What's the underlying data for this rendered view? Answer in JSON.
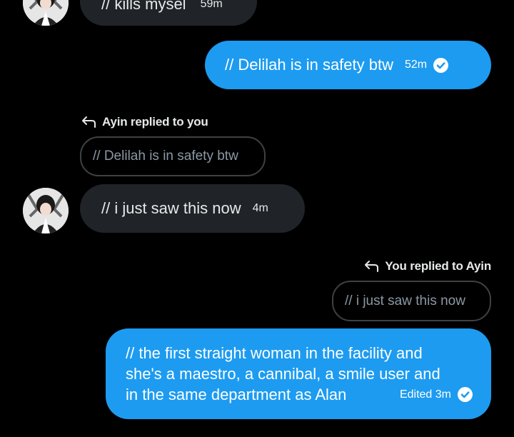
{
  "messages": {
    "top_in": {
      "text": "// kills mysel",
      "time": "59m"
    },
    "out1": {
      "text": "// Delilah is in safety btw",
      "time": "52m"
    },
    "reply1": {
      "label": "Ayin replied to you",
      "quote": "// Delilah is in safety btw"
    },
    "in2": {
      "text": "// i just saw this now",
      "time": "4m"
    },
    "reply2": {
      "label": "You replied to Ayin",
      "quote": "// i just saw this now"
    },
    "out2": {
      "lines": [
        "// the first straight woman in the facility and",
        "she's a maestro, a cannibal, a smile user and",
        "in the same department as Alan"
      ],
      "meta": "Edited 3m"
    }
  },
  "colors": {
    "background": "#000000",
    "incoming": "#202327",
    "outgoing": "#1d9bf0",
    "quote_border": "#3e4144"
  },
  "icons": {
    "reply": "reply-arrow-icon",
    "check": "check-circle-icon"
  }
}
